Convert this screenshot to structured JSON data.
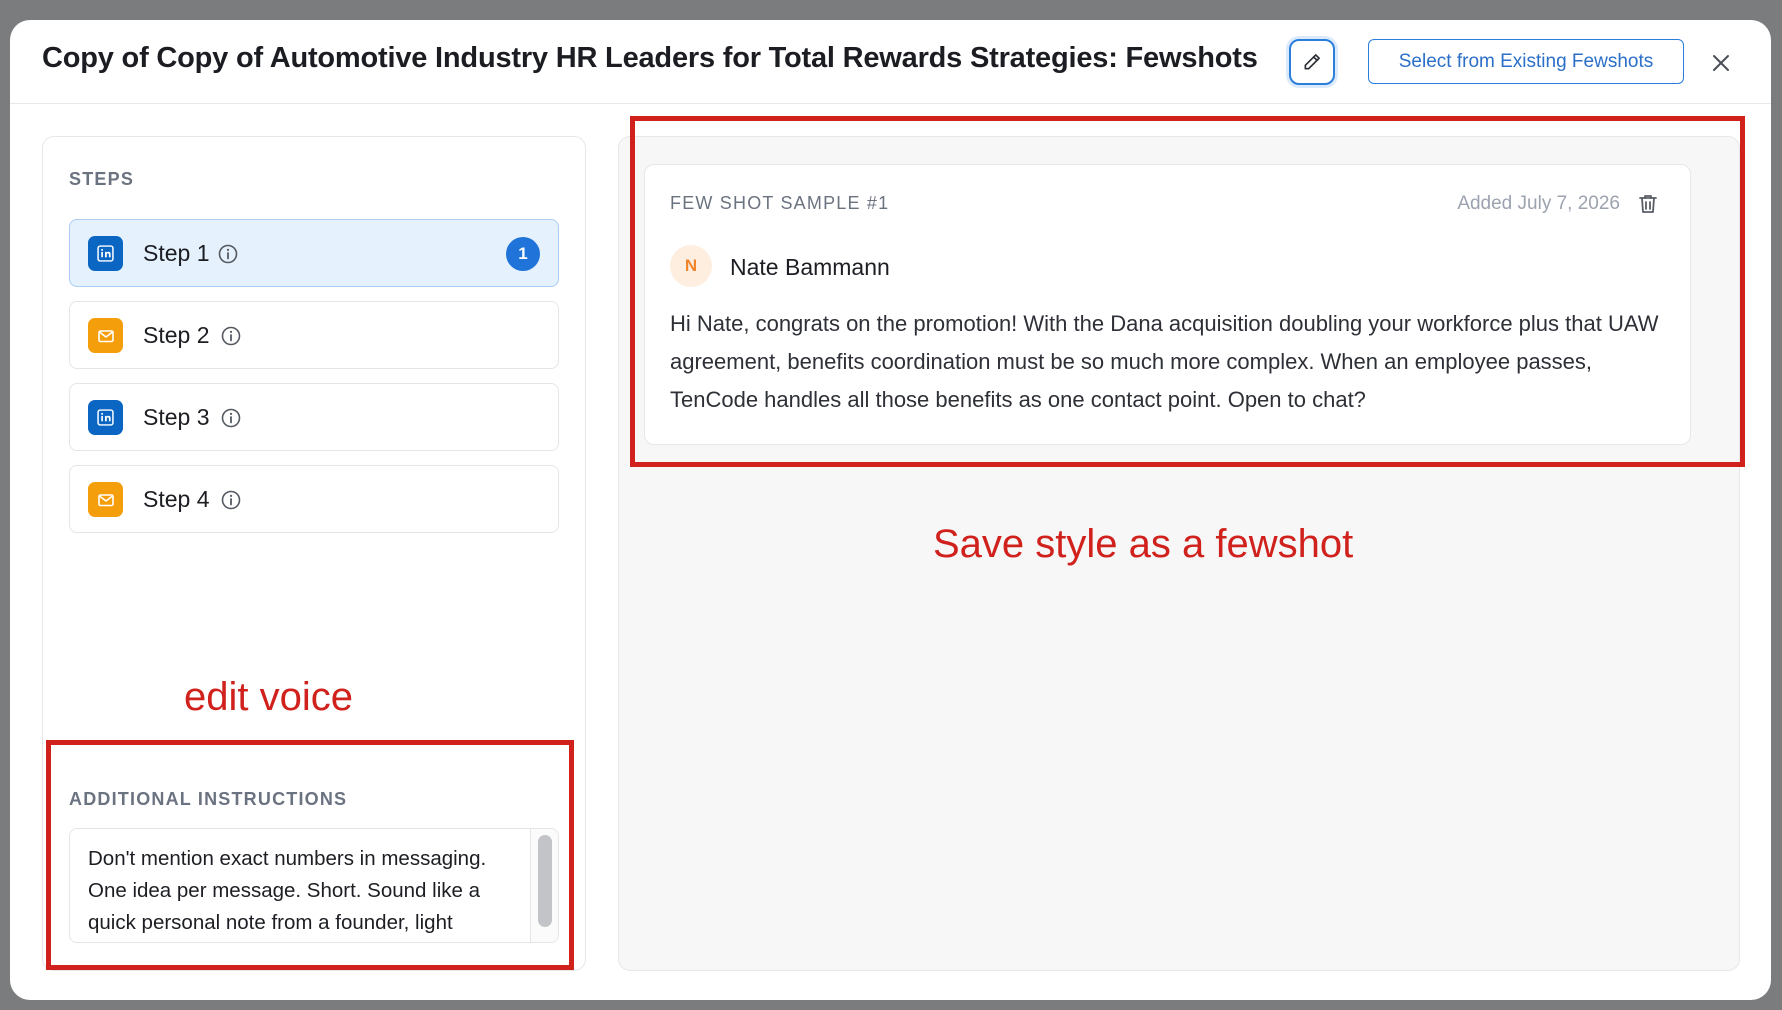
{
  "header": {
    "title": "Copy of Copy of Automotive Industry HR Leaders for Total Rewards Strategies: Fewshots",
    "select_button": "Select from Existing Fewshots",
    "close_icon": "close-icon",
    "edit_icon": "pencil-icon"
  },
  "steps": {
    "section_label": "STEPS",
    "items": [
      {
        "label": "Step 1",
        "channel": "linkedin",
        "active": true,
        "badge": "1"
      },
      {
        "label": "Step 2",
        "channel": "email",
        "active": false
      },
      {
        "label": "Step 3",
        "channel": "linkedin",
        "active": false
      },
      {
        "label": "Step 4",
        "channel": "email",
        "active": false
      }
    ]
  },
  "instructions": {
    "section_label": "ADDITIONAL INSTRUCTIONS",
    "text": "Don't mention exact numbers in messaging. One idea per message. Short. Sound like a quick personal note from a founder, light personalization."
  },
  "sample": {
    "title": "FEW SHOT SAMPLE #1",
    "date": "Added July 7, 2026",
    "avatar_initial": "N",
    "contact_name": "Nate Bammann",
    "message": "Hi Nate, congrats on the promotion! With the Dana acquisition doubling your workforce plus that UAW agreement, benefits coordination must be so much more complex. When an employee passes, TenCode handles all those benefits as one contact point. Open to chat?"
  },
  "annotations": {
    "left_label": "edit voice",
    "right_label": "Save style as a fewshot"
  },
  "colors": {
    "accent": "#1f73d9",
    "linkedin": "#0a66c2",
    "email": "#f59e0b",
    "annotation": "#d0211c"
  }
}
